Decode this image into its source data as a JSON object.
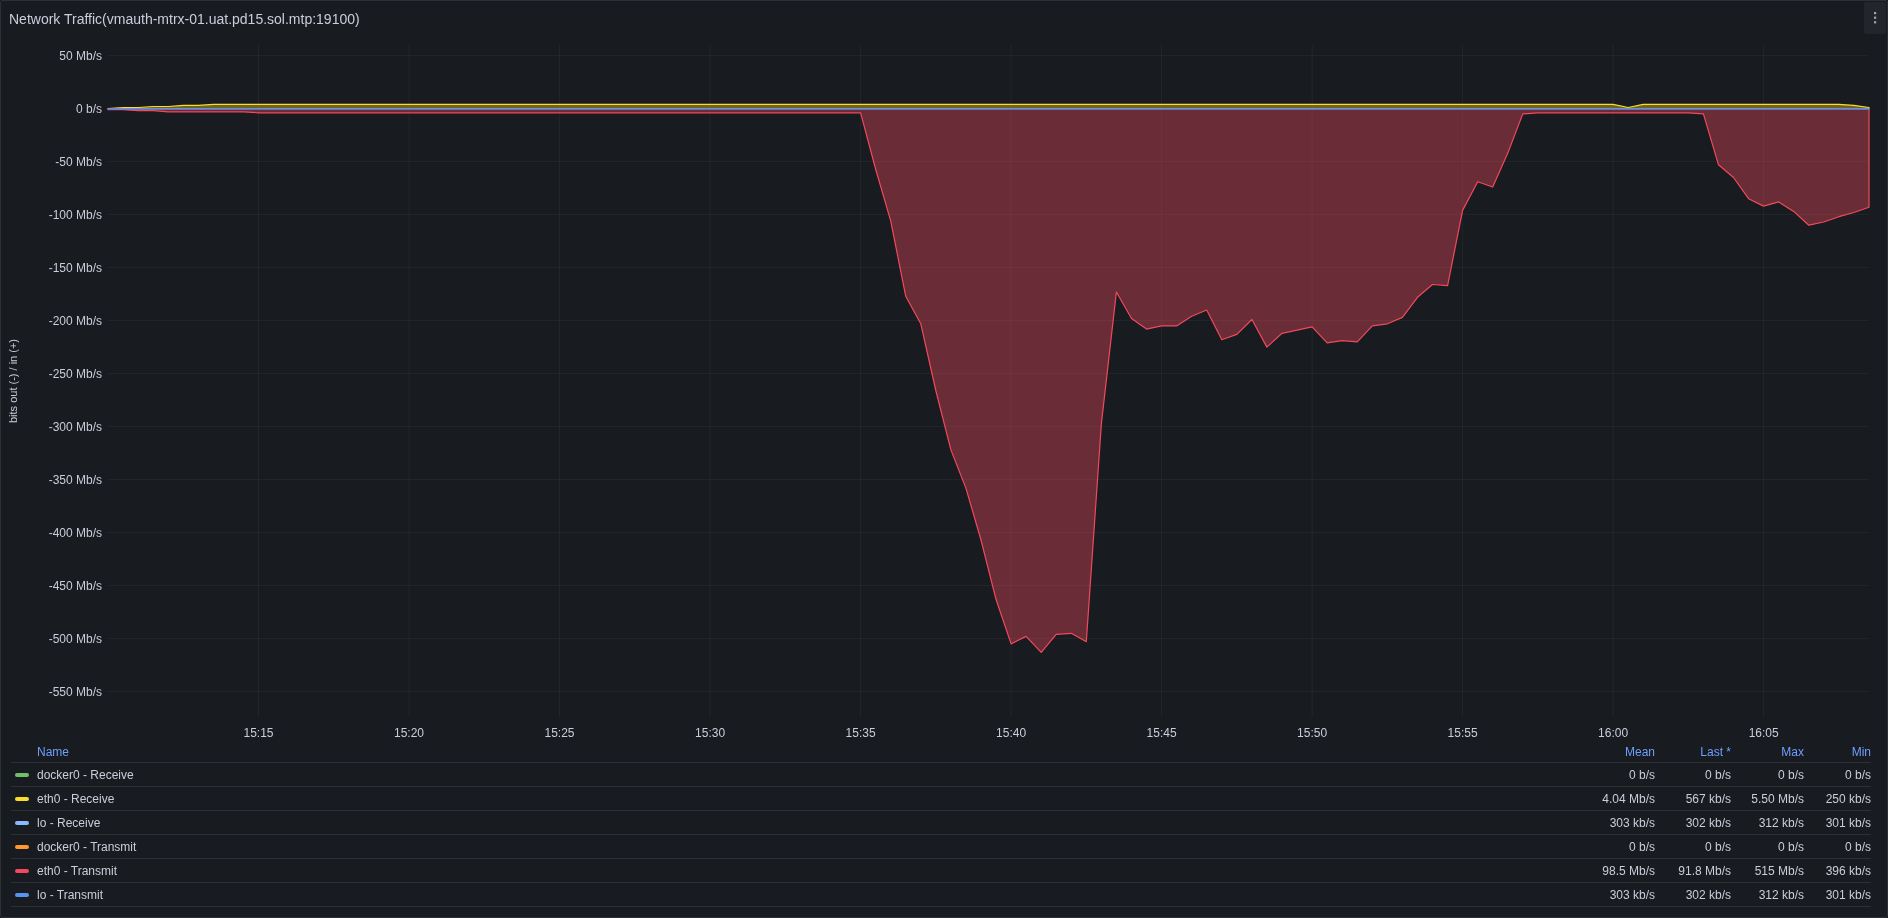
{
  "panel": {
    "title": "Network Traffic(vmauth-mtrx-01.uat.pd15.sol.mtp:19100)",
    "chart_data": {
      "type": "area",
      "grid": true,
      "ylabel": "bits out (-) / in (+)",
      "ylim": [
        -574,
        60
      ],
      "categories": [
        null,
        null,
        null,
        null,
        null,
        null,
        null,
        null,
        null,
        null,
        "15:15",
        null,
        null,
        null,
        null,
        null,
        null,
        null,
        null,
        null,
        "15:20",
        null,
        null,
        null,
        null,
        null,
        null,
        null,
        null,
        null,
        "15:25",
        null,
        null,
        null,
        null,
        null,
        null,
        null,
        null,
        null,
        "15:30",
        null,
        null,
        null,
        null,
        null,
        null,
        null,
        null,
        null,
        "15:35",
        null,
        null,
        null,
        null,
        null,
        null,
        null,
        null,
        null,
        "15:40",
        null,
        null,
        null,
        null,
        null,
        null,
        null,
        null,
        null,
        "15:45",
        null,
        null,
        null,
        null,
        null,
        null,
        null,
        null,
        null,
        "15:50",
        null,
        null,
        null,
        null,
        null,
        null,
        null,
        null,
        null,
        "15:55",
        null,
        null,
        null,
        null,
        null,
        null,
        null,
        null,
        null,
        "16:00",
        null,
        null,
        null,
        null,
        null,
        null,
        null,
        null,
        null,
        "16:05",
        null,
        null,
        null,
        null,
        null,
        null,
        null
      ],
      "series": [
        {
          "name": "eth0 - Receive",
          "color": "#fade2a",
          "values": [
            0,
            1,
            1,
            2,
            2,
            3,
            3,
            4,
            4,
            4,
            4,
            4,
            4,
            4,
            4,
            4,
            4,
            4,
            4,
            4,
            4,
            4,
            4,
            4,
            4,
            4,
            4,
            4,
            4,
            4,
            4,
            4,
            4,
            4,
            4,
            4,
            4,
            4,
            4,
            4,
            4,
            4,
            4,
            4,
            4,
            4,
            4,
            4,
            4,
            4,
            4,
            4,
            4,
            4,
            4,
            4,
            4,
            4,
            4,
            4,
            4,
            4,
            4,
            4,
            4,
            4,
            4,
            4,
            4,
            4,
            4,
            4,
            4,
            4,
            4,
            4,
            4,
            4,
            4,
            4,
            4,
            4,
            4,
            4,
            4,
            4,
            4,
            4,
            4,
            4,
            4,
            4,
            4,
            4,
            4,
            4,
            4,
            4,
            4,
            4,
            4,
            1,
            4,
            4,
            4,
            4,
            4,
            4,
            4,
            4,
            4,
            4,
            4,
            4,
            4,
            4,
            3,
            1
          ]
        },
        {
          "name": "eth0 - Transmit",
          "color": "#f2495c",
          "values": [
            -1,
            -1,
            -2,
            -2,
            -3,
            -3,
            -3,
            -3,
            -3,
            -3,
            -4,
            -4,
            -4,
            -4,
            -4,
            -4,
            -4,
            -4,
            -4,
            -4,
            -4,
            -4,
            -4,
            -4,
            -4,
            -4,
            -4,
            -4,
            -4,
            -4,
            -4,
            -4,
            -4,
            -4,
            -4,
            -4,
            -4,
            -4,
            -4,
            -4,
            -4,
            -4,
            -4,
            -4,
            -4,
            -4,
            -4,
            -4,
            -4,
            -4,
            -4,
            -57,
            -106,
            -177,
            -203,
            -266,
            -322,
            -358,
            -407,
            -463,
            -505,
            -498,
            -513,
            -496,
            -495,
            -503,
            -297,
            -173,
            -198,
            -208,
            -205,
            -205,
            -196,
            -190,
            -218,
            -213,
            -199,
            -225,
            -212,
            -209,
            -206,
            -221,
            -219,
            -220,
            -205,
            -203,
            -197,
            -178,
            -166,
            -167,
            -96,
            -69,
            -74,
            -42,
            -5,
            -4,
            -4,
            -4,
            -4,
            -4,
            -4,
            -4,
            -4,
            -4,
            -4,
            -4,
            -5,
            -53,
            -65,
            -85,
            -92,
            -88,
            -97,
            -110,
            -107,
            -102,
            -98,
            -93
          ]
        },
        {
          "name": "lo - Transmit",
          "color": "#5794f2",
          "values": [
            -0.3,
            -0.3,
            -0.3,
            -0.3,
            -0.3,
            -0.3,
            -0.3,
            -0.3,
            -0.3,
            -0.3,
            -0.3,
            -0.3,
            -0.3,
            -0.3,
            -0.3,
            -0.3,
            -0.3,
            -0.3,
            -0.3,
            -0.3,
            -0.3,
            -0.3,
            -0.3,
            -0.3,
            -0.3,
            -0.3,
            -0.3,
            -0.3,
            -0.3,
            -0.3,
            -0.3,
            -0.3,
            -0.3,
            -0.3,
            -0.3,
            -0.3,
            -0.3,
            -0.3,
            -0.3,
            -0.3,
            -0.3,
            -0.3,
            -0.3,
            -0.3,
            -0.3,
            -0.3,
            -0.3,
            -0.3,
            -0.3,
            -0.3,
            -0.3,
            -0.3,
            -0.3,
            -0.3,
            -0.3,
            -0.3,
            -0.3,
            -0.3,
            -0.3,
            -0.3,
            -0.3,
            -0.3,
            -0.3,
            -0.3,
            -0.3,
            -0.3,
            -0.3,
            -0.3,
            -0.3,
            -0.3,
            -0.3,
            -0.3,
            -0.3,
            -0.3,
            -0.3,
            -0.3,
            -0.3,
            -0.3,
            -0.3,
            -0.3,
            -0.3,
            -0.3,
            -0.3,
            -0.3,
            -0.3,
            -0.3,
            -0.3,
            -0.3,
            -0.3,
            -0.3,
            -0.3,
            -0.3,
            -0.3,
            -0.3,
            -0.3,
            -0.3,
            -0.3,
            -0.3,
            -0.3,
            -0.3,
            -0.3,
            -0.3,
            -0.3,
            -0.3,
            -0.3,
            -0.3,
            -0.3,
            -0.3,
            -0.3,
            -0.3,
            -0.3,
            -0.3,
            -0.3,
            -0.3,
            -0.3,
            -0.3,
            -0.3,
            -0.3
          ]
        }
      ],
      "yticks": [
        {
          "value": 50,
          "label": "50 Mb/s"
        },
        {
          "value": 0,
          "label": "0 b/s"
        },
        {
          "value": -50,
          "label": "-50 Mb/s"
        },
        {
          "value": -100,
          "label": "-100 Mb/s"
        },
        {
          "value": -150,
          "label": "-150 Mb/s"
        },
        {
          "value": -200,
          "label": "-200 Mb/s"
        },
        {
          "value": -250,
          "label": "-250 Mb/s"
        },
        {
          "value": -300,
          "label": "-300 Mb/s"
        },
        {
          "value": -350,
          "label": "-350 Mb/s"
        },
        {
          "value": -400,
          "label": "-400 Mb/s"
        },
        {
          "value": -450,
          "label": "-450 Mb/s"
        },
        {
          "value": -500,
          "label": "-500 Mb/s"
        },
        {
          "value": -550,
          "label": "-550 Mb/s"
        }
      ]
    },
    "legend": {
      "columns": [
        "Name",
        "Mean",
        "Last *",
        "Max",
        "Min"
      ],
      "rows": [
        {
          "name": "docker0 - Receive",
          "color": "#73bf69",
          "values": [
            "0 b/s",
            "0 b/s",
            "0 b/s",
            "0 b/s"
          ]
        },
        {
          "values": [
            "4.04 Mb/s",
            "567 kb/s",
            "5.50 Mb/s",
            "250 kb/s"
          ]
        },
        {
          "name": "lo - Receive",
          "color": "#8ab8ff",
          "values": [
            "303 kb/s",
            "302 kb/s",
            "312 kb/s",
            "301 kb/s"
          ]
        },
        {
          "name": "docker0 - Transmit",
          "color": "#ff9830",
          "values": [
            "0 b/s",
            "0 b/s",
            "0 b/s",
            "0 b/s"
          ]
        },
        {
          "values": [
            "98.5 Mb/s",
            "91.8 Mb/s",
            "515 Mb/s",
            "396 kb/s"
          ]
        },
        {
          "values": [
            "303 kb/s",
            "302 kb/s",
            "312 kb/s",
            "301 kb/s"
          ]
        }
      ]
    }
  }
}
